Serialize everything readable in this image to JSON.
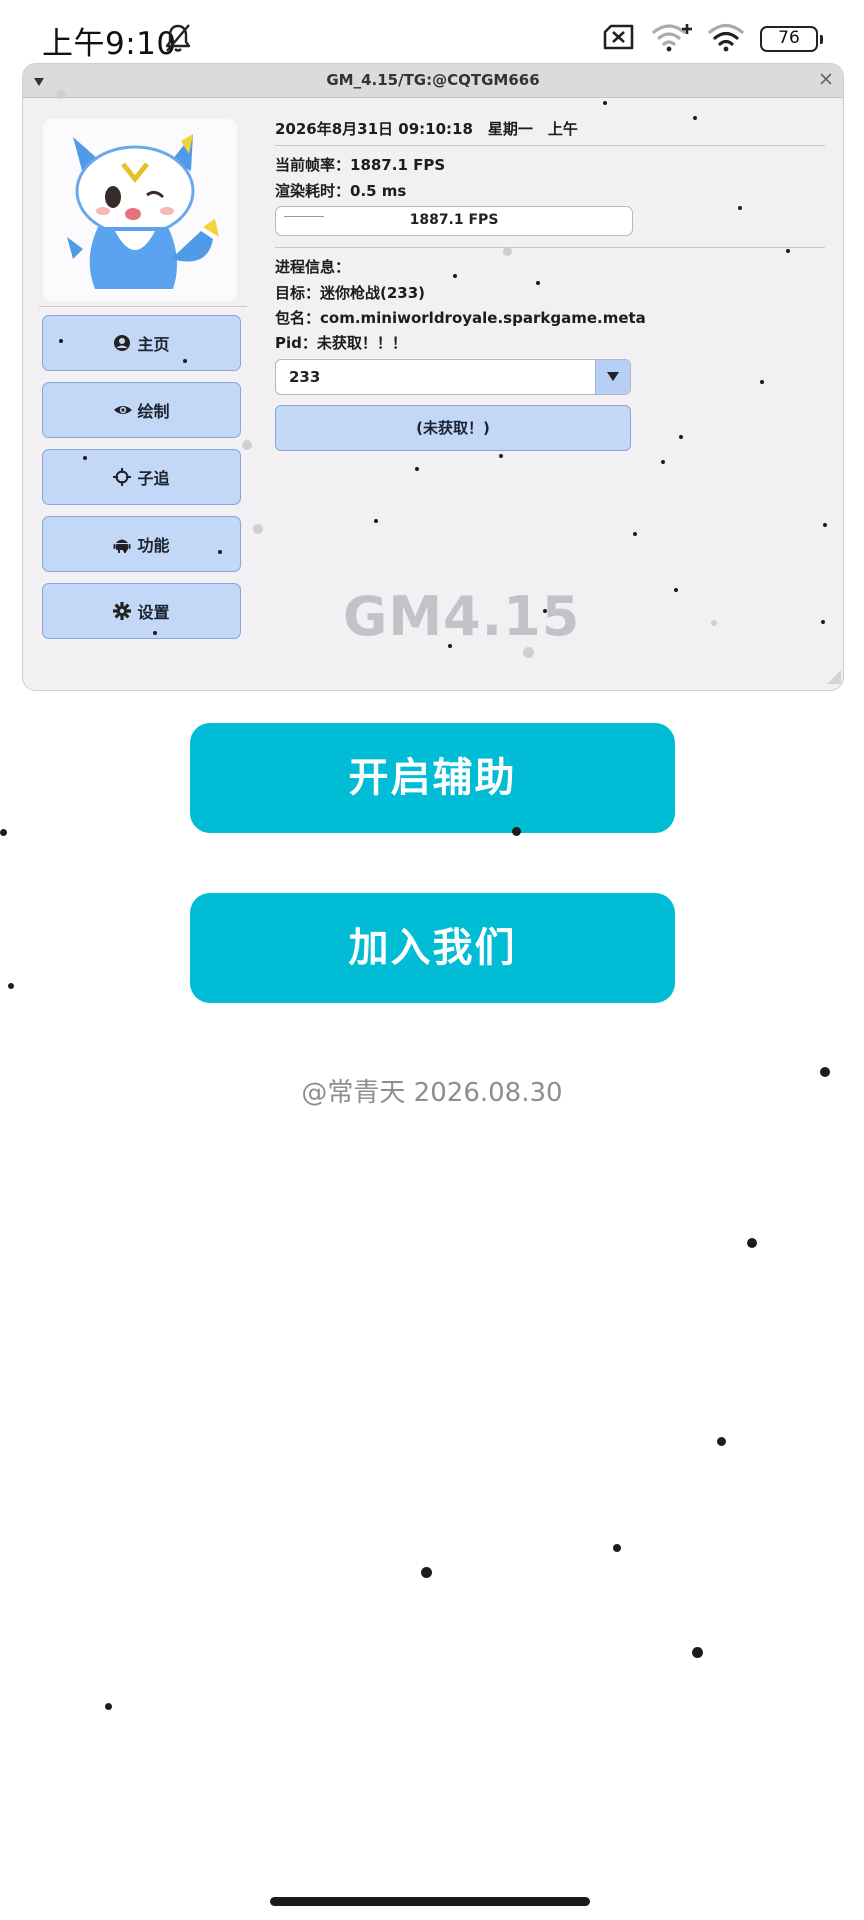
{
  "status_bar": {
    "time": "上午9:10",
    "battery": "76",
    "icons": [
      "bell-muted-icon",
      "sim-off-icon",
      "wifi-plus-icon",
      "wifi-icon",
      "battery-icon"
    ]
  },
  "panel": {
    "title": "GM_4.15/TG:@CQTGM666",
    "collapse_glyph": "▼",
    "close_glyph": "×",
    "nav": [
      {
        "label": "主页",
        "icon": "user-circle-icon"
      },
      {
        "label": "绘制",
        "icon": "eye-icon"
      },
      {
        "label": "子追",
        "icon": "crosshair-icon"
      },
      {
        "label": "功能",
        "icon": "android-icon"
      },
      {
        "label": "设置",
        "icon": "gear-icon"
      }
    ],
    "datetime": "2026年8月31日 09:10:18　星期一　上午",
    "fps_line": "当前帧率：1887.1 FPS",
    "render_line": "渲染耗时：0.5 ms",
    "fps_bar_text": "1887.1 FPS",
    "process_header": "进程信息：",
    "target_line": "目标：迷你枪战(233)",
    "package_line": "包名：com.miniworldroyale.sparkgame.meta",
    "pid_line": "Pid：未获取！！！",
    "select_value": "233",
    "fetch_button": "(未获取！)",
    "watermark": "GM4.15"
  },
  "buttons": {
    "start": "开启辅助",
    "join": "加入我们"
  },
  "footer": "@常青天 2026.08.30",
  "colors": {
    "accent": "#00bcd4",
    "nav_button_bg": "#c3d8f7",
    "panel_bg": "#f2f0f3"
  }
}
